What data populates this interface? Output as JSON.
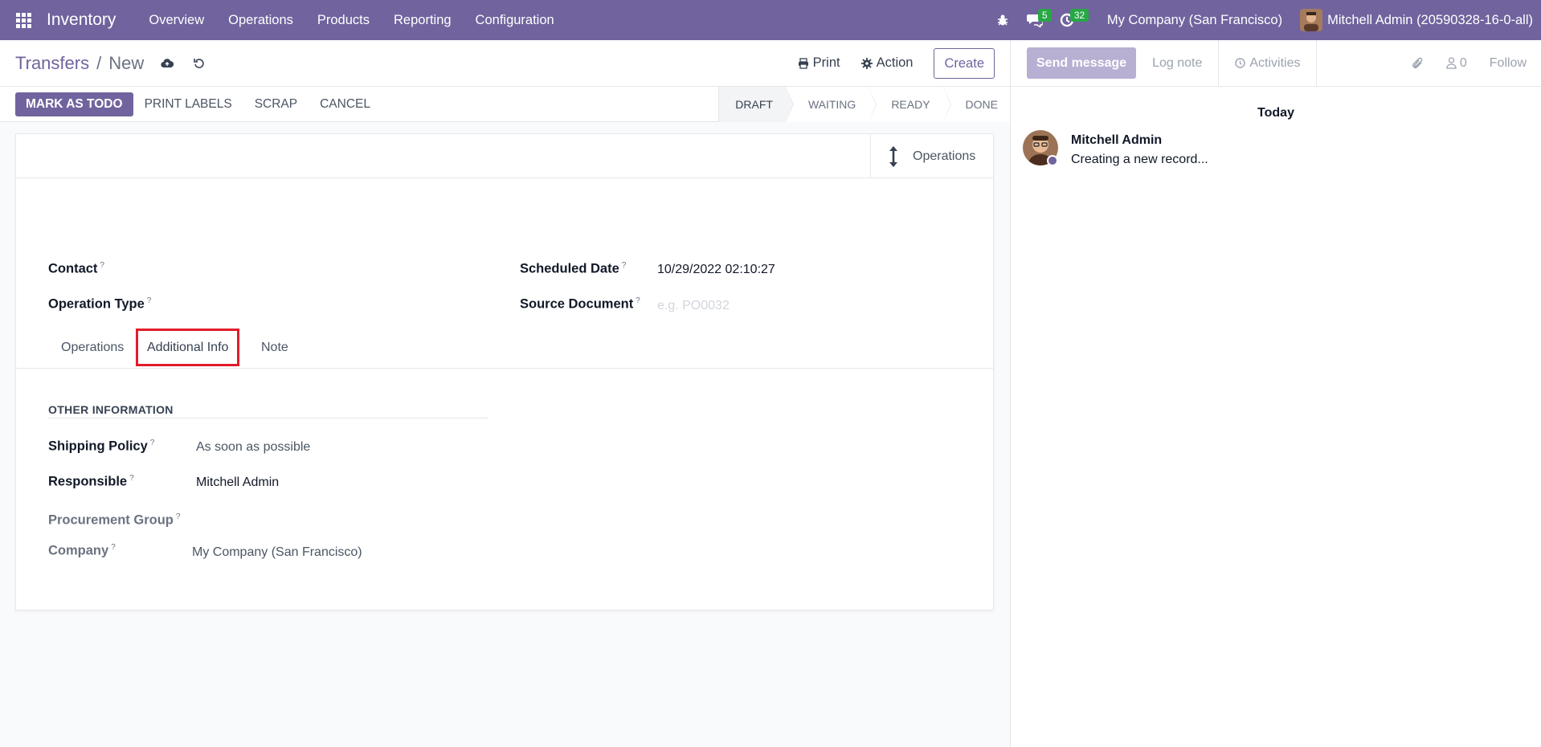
{
  "navbar": {
    "brand": "Inventory",
    "menu": [
      "Overview",
      "Operations",
      "Products",
      "Reporting",
      "Configuration"
    ],
    "messages_badge": "5",
    "activities_badge": "32",
    "company": "My Company (San Francisco)",
    "user": "Mitchell Admin (20590328-16-0-all)"
  },
  "control_panel": {
    "breadcrumb_parent": "Transfers",
    "breadcrumb_current": "New",
    "print_label": "Print",
    "action_label": "Action",
    "create_label": "Create"
  },
  "statusbar": {
    "buttons": [
      "MARK AS TODO",
      "PRINT LABELS",
      "SCRAP",
      "CANCEL"
    ],
    "stages": [
      "DRAFT",
      "WAITING",
      "READY",
      "DONE"
    ],
    "active_stage": "DRAFT"
  },
  "form": {
    "smart_button": "Operations",
    "contact_label": "Contact",
    "operation_type_label": "Operation Type",
    "scheduled_date_label": "Scheduled Date",
    "scheduled_date_value": "10/29/2022 02:10:27",
    "source_document_label": "Source Document",
    "source_document_placeholder": "e.g. PO0032",
    "help_marker": "?",
    "tabs": [
      "Operations",
      "Additional Info",
      "Note"
    ],
    "active_tab": "Additional Info",
    "section_title": "OTHER INFORMATION",
    "shipping_policy_label": "Shipping Policy",
    "shipping_policy_value": "As soon as possible",
    "responsible_label": "Responsible",
    "responsible_value": "Mitchell Admin",
    "procurement_group_label": "Procurement Group",
    "company_label": "Company",
    "company_value": "My Company (San Francisco)"
  },
  "chatter": {
    "send_message": "Send message",
    "log_note": "Log note",
    "activities": "Activities",
    "followers_count": "0",
    "follow": "Follow",
    "day": "Today",
    "message_author": "Mitchell Admin",
    "message_text": "Creating a new record..."
  },
  "colors": {
    "brand": "#71639e",
    "badge": "#28a745",
    "highlight": "#e11d2a"
  }
}
